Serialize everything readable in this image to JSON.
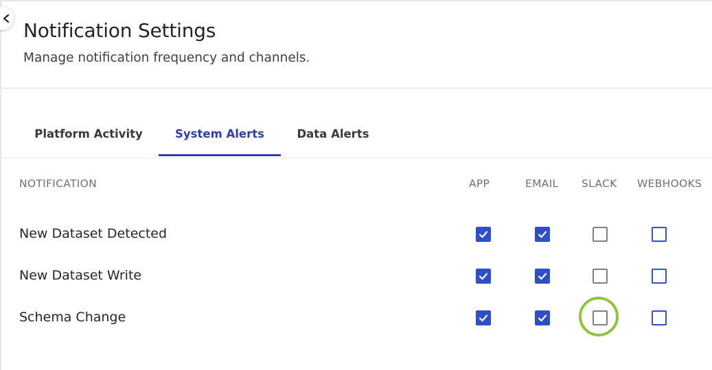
{
  "header": {
    "title": "Notification Settings",
    "subtitle": "Manage notification frequency and channels."
  },
  "tabs": [
    {
      "label": "Platform Activity",
      "active": false
    },
    {
      "label": "System Alerts",
      "active": true
    },
    {
      "label": "Data Alerts",
      "active": false
    }
  ],
  "table": {
    "columns": [
      "NOTIFICATION",
      "APP",
      "EMAIL",
      "SLACK",
      "WEBHOOKS"
    ],
    "rows": [
      {
        "label": "New Dataset Detected",
        "app": true,
        "email": true,
        "slack": false,
        "webhooks": false
      },
      {
        "label": "New Dataset Write",
        "app": true,
        "email": true,
        "slack": false,
        "webhooks": false
      },
      {
        "label": "Schema Change",
        "app": true,
        "email": true,
        "slack": false,
        "webhooks": false
      }
    ]
  },
  "colors": {
    "accent": "#2f4fc9",
    "active_tab": "#2f3ea8",
    "highlight": "#8ec63f"
  },
  "icons": {
    "back": "close-icon",
    "check": "checkmark-icon"
  }
}
